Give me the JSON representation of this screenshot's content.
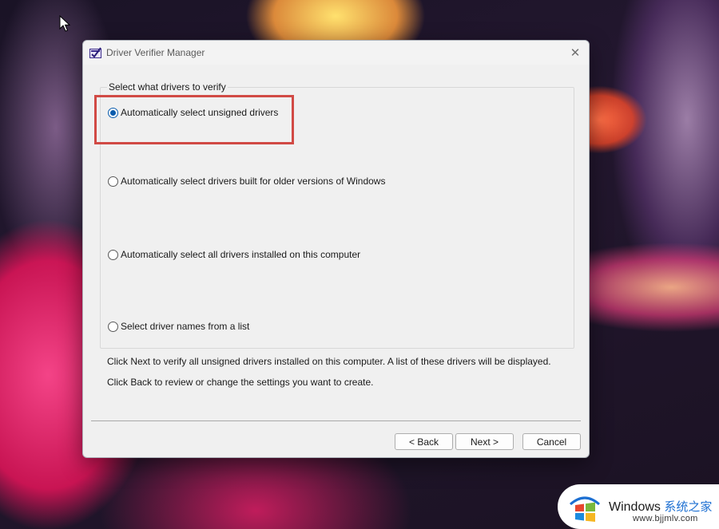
{
  "window": {
    "title": "Driver Verifier Manager",
    "close_glyph": "✕"
  },
  "group": {
    "legend": "Select what drivers to verify",
    "options": [
      {
        "label": "Automatically select unsigned drivers",
        "selected": true
      },
      {
        "label": "Automatically select drivers built for older versions of Windows",
        "selected": false
      },
      {
        "label": "Automatically select all drivers installed on this computer",
        "selected": false
      },
      {
        "label": "Select driver names from a list",
        "selected": false
      }
    ]
  },
  "info": {
    "line1": "Click Next to verify all unsigned drivers installed on this computer. A list of these drivers will be displayed.",
    "line2": "Click Back to review or change the settings you want to create."
  },
  "buttons": {
    "back": "< Back",
    "next": "Next >",
    "cancel": "Cancel"
  },
  "highlight": {
    "color": "#d14a45"
  },
  "watermark": {
    "brand": "Windows",
    "brand_cn": "系统之家",
    "url": "www.bjjmlv.com"
  },
  "colors": {
    "accent": "#0b5cad",
    "dialog_bg": "#f0f0f0"
  }
}
